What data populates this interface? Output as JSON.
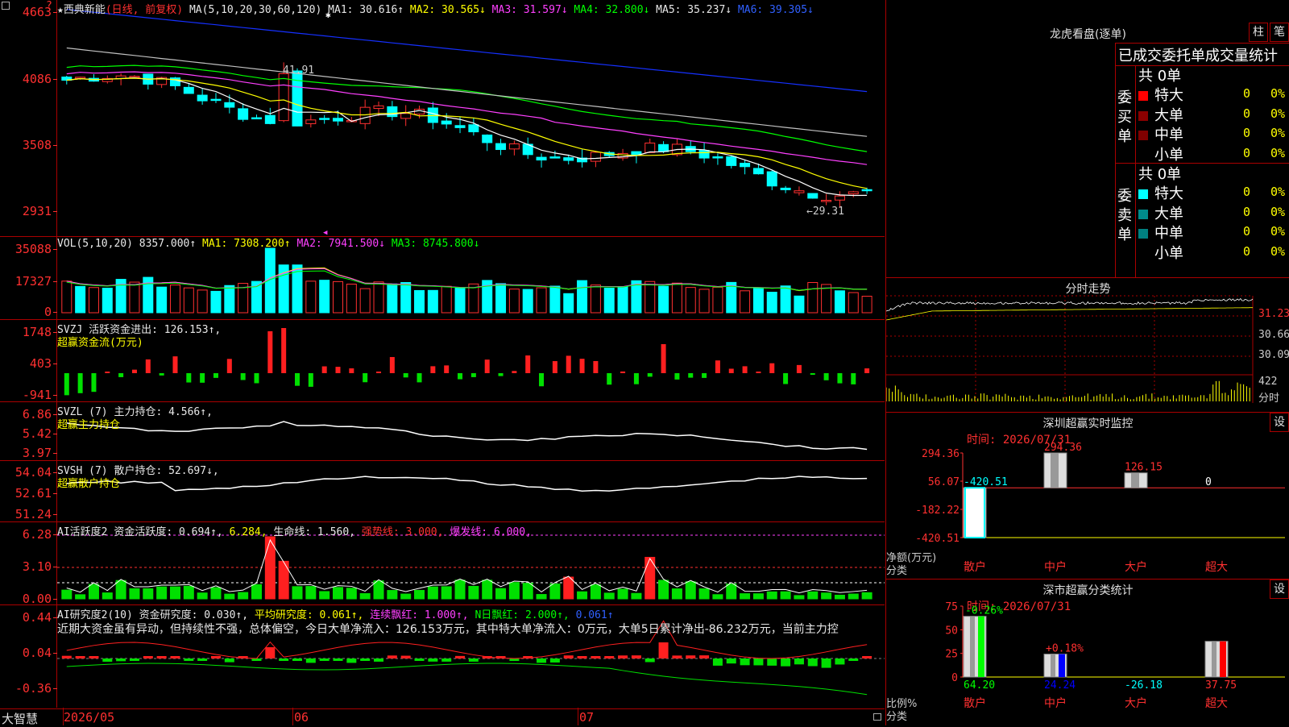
{
  "main": {
    "stock_name": "★西典新能",
    "period_label": "(日线, 前复权)",
    "ma_params": "MA(5,10,20,30,60,120)",
    "ma1": "MA1: 30.616↑",
    "ma2": "MA2: 30.565↓",
    "ma3": "MA3: 31.597↓",
    "ma4": "MA4: 32.800↓",
    "ma5": "MA5: 35.237↓",
    "ma6": "MA6: 39.305↓",
    "y_labels": [
      "4663",
      "4086",
      "3508",
      "2931"
    ],
    "high_mark": "41.91",
    "low_mark": "←29.31",
    "colors": {
      "up": "#ff3030",
      "down": "#00ffff",
      "ma1": "#ffffff",
      "ma2": "#ffff00",
      "ma3": "#ff40ff",
      "ma4": "#00ff00",
      "ma5": "#c0c0c0",
      "ma6": "#1530ff"
    }
  },
  "vol": {
    "params": "VOL(5,10,20)",
    "value": "8357.000↑",
    "ma1": "MA1: 7308.200↑",
    "ma2": "MA2: 7941.500↓",
    "ma3": "MA3: 8745.800↓",
    "y_labels": [
      "35088",
      "17327",
      "0"
    ]
  },
  "svzj": {
    "name": "SVZJ",
    "line1": "活跃资金进出: 126.153↑,",
    "line2": "超赢资金流(万元)",
    "y_labels": [
      "1748",
      "403",
      "-941"
    ]
  },
  "svzl": {
    "name": "SVZL (7)",
    "line1": "主力持仓: 4.566↑,",
    "line2": "超赢主力持仓",
    "y_labels": [
      "6.86",
      "5.42",
      "3.97"
    ]
  },
  "svsh": {
    "name": "SVSH (7)",
    "line1": "散户持仓: 52.697↓,",
    "line2": "超赢散户持仓",
    "y_labels": [
      "54.04",
      "52.61",
      "51.24"
    ]
  },
  "ai_active": {
    "name": "AI活跃度2",
    "active": "资金活跃度: 0.694↑,",
    "v2": "6.284,",
    "life": "生命线: 1.560,",
    "strong": "强势线: 3.000,",
    "burst": "爆发线: 6.000,",
    "y_labels": [
      "6.28",
      "3.10",
      "0.00"
    ]
  },
  "ai_research": {
    "name": "AI研究度2(10)",
    "research": "资金研究度: 0.030↑,",
    "avg": "平均研究度: 0.061↑,",
    "streak": "连续飘红: 1.000↑,",
    "nday": "N日飘红: 2.000↑,",
    "last": "0.061↑",
    "comment": "近期大资金虽有异动，但持续性不强，总体偏空，今日大单净流入：126.153万元，其中特大单净流入：0万元，大单5日累计净出-86.232万元，当前主力控",
    "y_labels": [
      "0.44",
      "0.04",
      "-0.36"
    ]
  },
  "xaxis": {
    "corner_label": "大智慧",
    "dates": [
      "2026/05",
      "06",
      "07"
    ]
  },
  "right": {
    "lhb_title": "龙虎看盘(逐单)",
    "btn_col": "柱",
    "btn_bi": "笔",
    "stat_header": "已成交委托单成交量统计",
    "buy": {
      "side_label": "委买单",
      "total": "共 0单",
      "rows": [
        {
          "label": "特大",
          "count": "0",
          "pct": "0%",
          "color": "#ff0000"
        },
        {
          "label": "大单",
          "count": "0",
          "pct": "0%",
          "color": "#8b0000"
        },
        {
          "label": "中单",
          "count": "0",
          "pct": "0%",
          "color": "#800000"
        },
        {
          "label": "小单",
          "count": "0",
          "pct": "0%",
          "color": ""
        }
      ]
    },
    "sell": {
      "side_label": "委卖单",
      "total": "共 0单",
      "rows": [
        {
          "label": "特大",
          "count": "0",
          "pct": "0%",
          "color": "#00ffff"
        },
        {
          "label": "大单",
          "count": "0",
          "pct": "0%",
          "color": "#008b8b"
        },
        {
          "label": "中单",
          "count": "0",
          "pct": "0%",
          "color": "#008080"
        },
        {
          "label": "小单",
          "count": "0",
          "pct": "0%",
          "color": ""
        }
      ]
    },
    "intraday": {
      "title": "分时走势",
      "prices": [
        "31.23",
        "30.66",
        "30.09"
      ],
      "vol_label": "422",
      "vol_unit": "分时"
    },
    "sz_monitor": {
      "title": "深圳超赢实时监控",
      "btn": "设",
      "time": "时间: 2026/07/31",
      "y_labels": [
        "294.36",
        "56.07",
        "-182.22",
        "-420.51"
      ],
      "y_name": "净额(万元)",
      "x_name": "分类",
      "chart_data": {
        "type": "bar",
        "categories": [
          "散户",
          "中户",
          "大户",
          "超大"
        ],
        "values": [
          -420.51,
          294.36,
          126.15,
          0
        ],
        "value_labels": [
          "-420.51",
          "294.36",
          "126.15",
          "0"
        ],
        "ylim": [
          -420.51,
          294.36
        ]
      }
    },
    "sz_class": {
      "title": "深市超赢分类统计",
      "btn": "设",
      "time": "时间: 2026/07/31",
      "y_labels": [
        "75",
        "50",
        "25",
        "0"
      ],
      "y_name": "比例%",
      "x_name": "分类",
      "chart_data": {
        "type": "bar",
        "categories": [
          "散户",
          "中户",
          "大户",
          "超大"
        ],
        "values": [
          64.2,
          24.24,
          -26.18,
          37.75
        ],
        "value_labels": [
          "64.20",
          "24.24",
          "-26.18",
          "37.75"
        ],
        "changes": [
          "-0.26%",
          "+0.18%",
          "",
          ""
        ],
        "ylim": [
          0,
          75
        ]
      }
    }
  }
}
